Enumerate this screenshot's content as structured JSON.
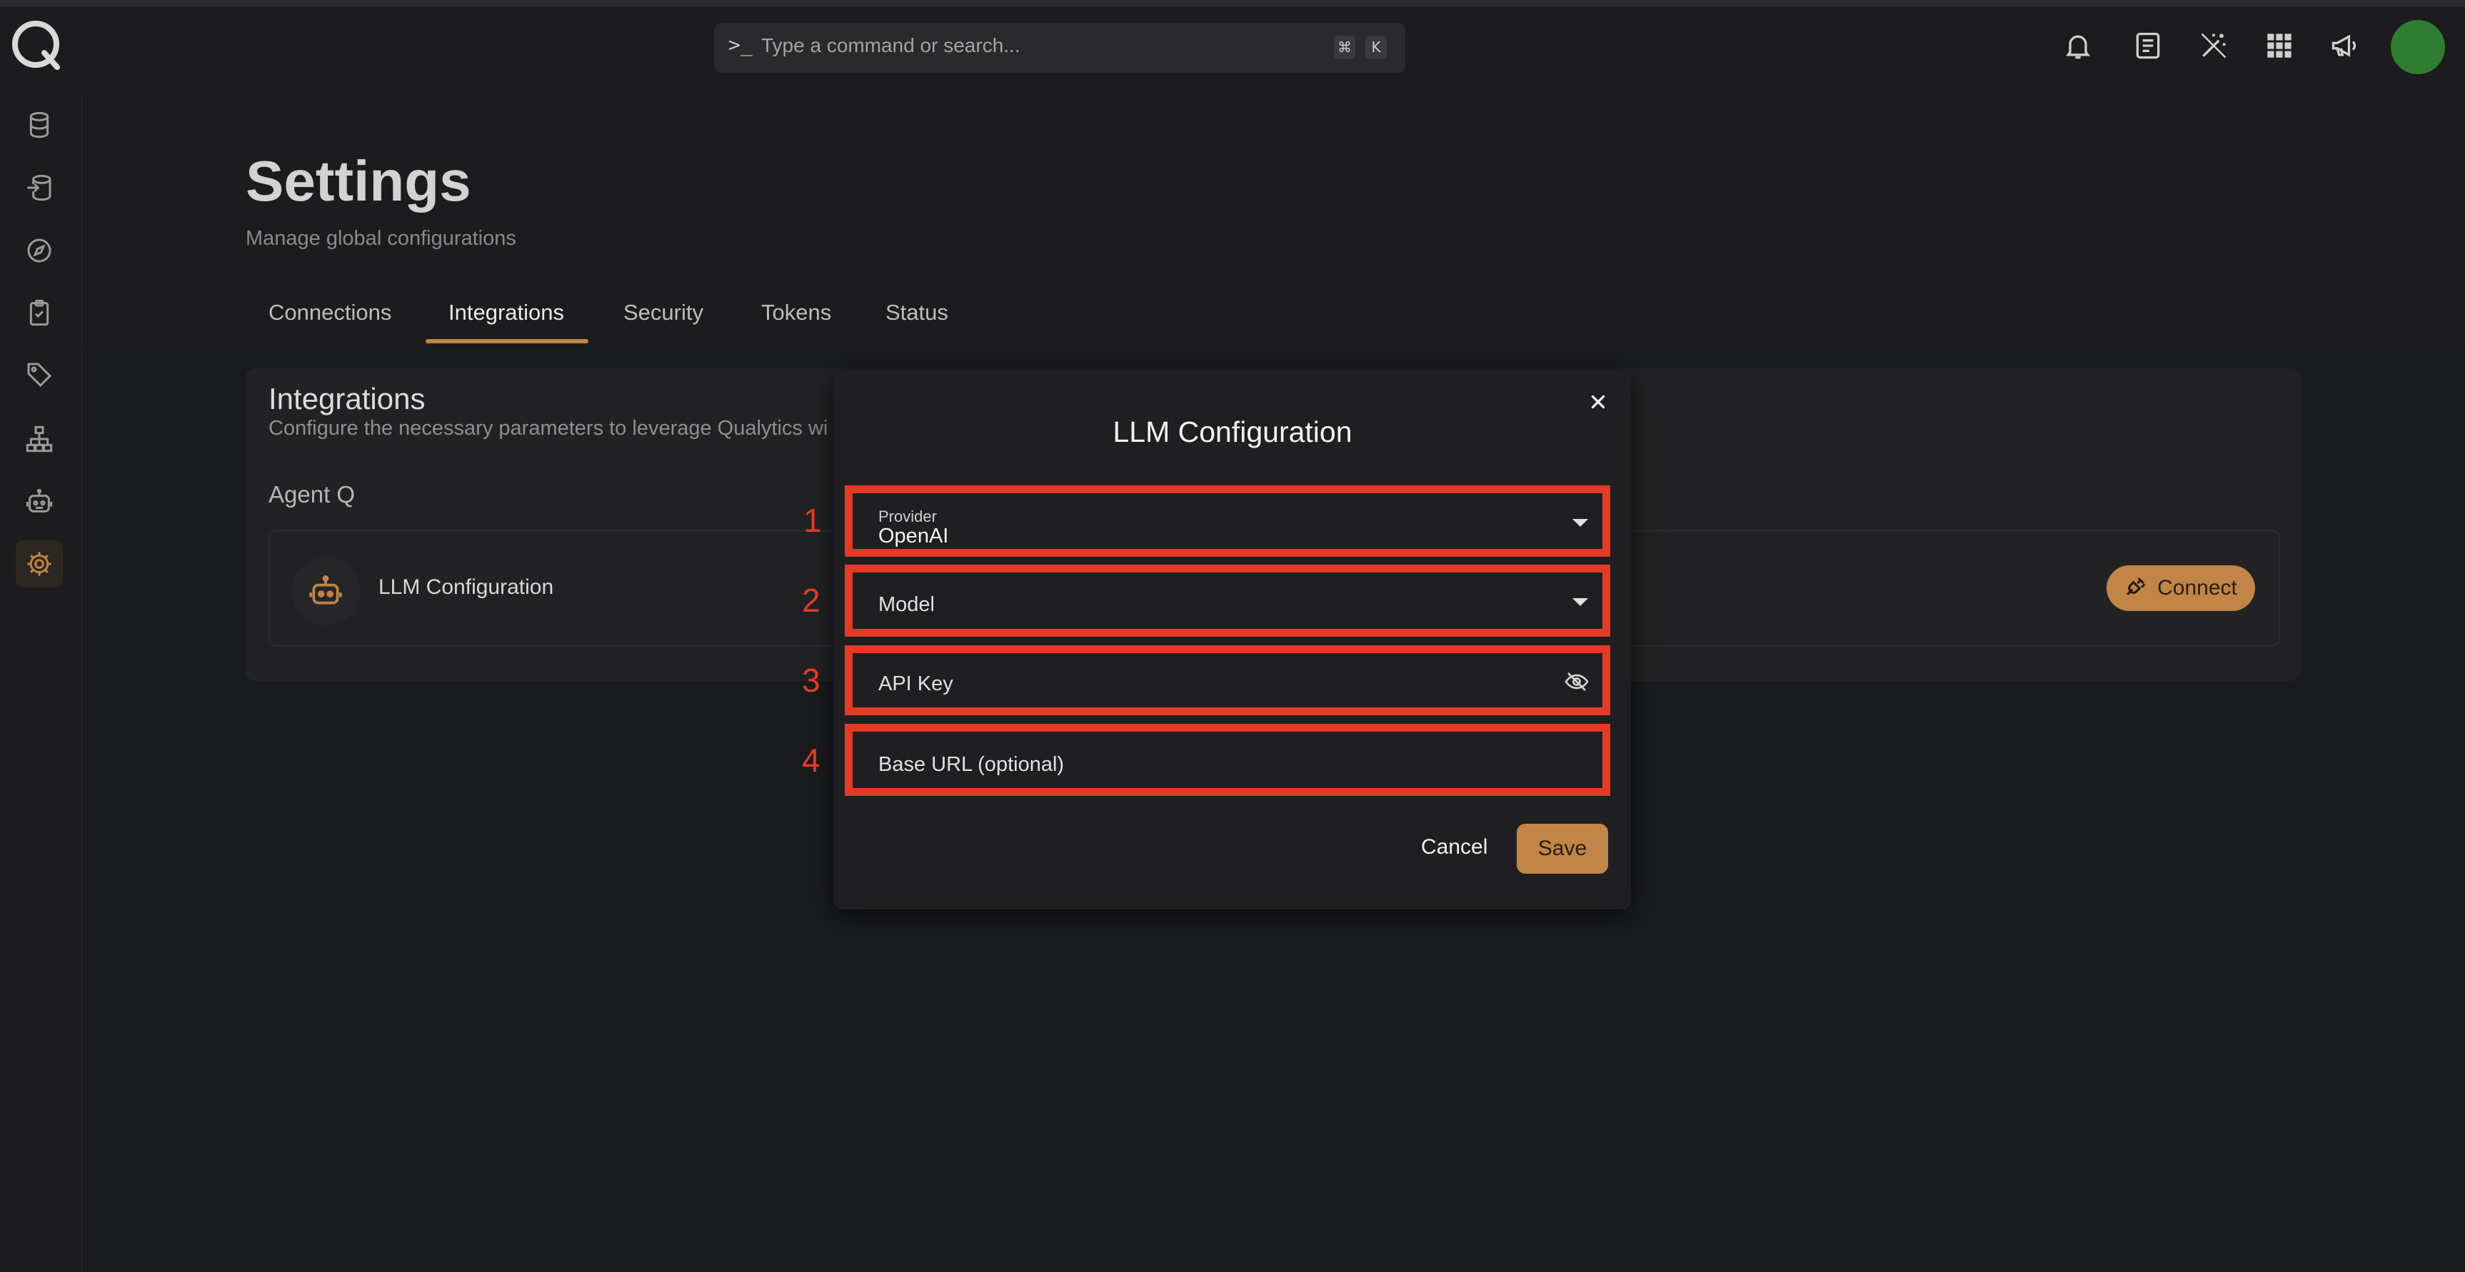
{
  "command_bar": {
    "prompt_glyph": ">_",
    "placeholder": "Type a command or search...",
    "shortcut_keys": [
      "⌘",
      "K"
    ]
  },
  "top_icons": [
    "bell-icon",
    "document-icon",
    "magic-wand-icon",
    "apps-grid-icon",
    "megaphone-icon"
  ],
  "sidebar": {
    "items": [
      "database-icon",
      "database-import-icon",
      "compass-icon",
      "clipboard-check-icon",
      "tag-icon",
      "sitemap-icon",
      "robot-icon",
      "gear-icon"
    ],
    "active": "gear-icon"
  },
  "page": {
    "title": "Settings",
    "subtitle": "Manage global configurations"
  },
  "tabs": [
    {
      "label": "Connections"
    },
    {
      "label": "Integrations",
      "active": true
    },
    {
      "label": "Security"
    },
    {
      "label": "Tokens"
    },
    {
      "label": "Status"
    }
  ],
  "integrations": {
    "title": "Integrations",
    "description": "Configure the necessary parameters to leverage Qualytics wi",
    "section": "Agent Q",
    "item": {
      "name": "LLM Configuration",
      "connect_label": "Connect"
    }
  },
  "dialog": {
    "title": "LLM Configuration",
    "fields": [
      {
        "number": "1",
        "label": "Provider",
        "value": "OpenAI"
      },
      {
        "number": "2",
        "placeholder": "Model"
      },
      {
        "number": "3",
        "placeholder": "API Key"
      },
      {
        "number": "4",
        "placeholder": "Base URL (optional)"
      }
    ],
    "cancel_label": "Cancel",
    "save_label": "Save"
  },
  "colors": {
    "accent": "#c08547",
    "highlight": "#e53a26",
    "avatar": "#2f7d32"
  }
}
